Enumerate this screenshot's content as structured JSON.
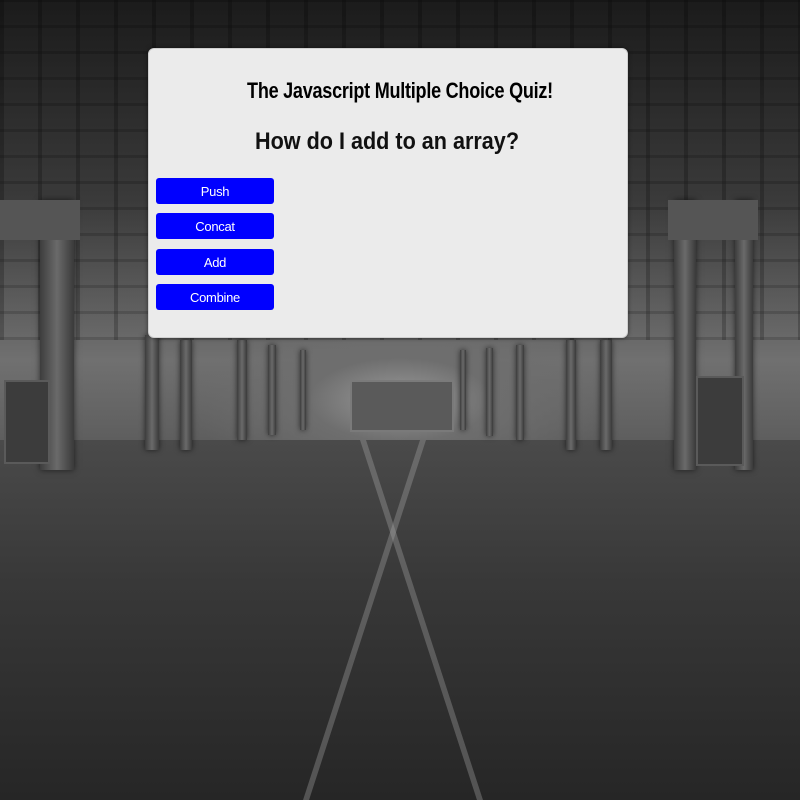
{
  "quiz": {
    "title": "The Javascript Multiple Choice Quiz!",
    "question": "How do I add to an array?",
    "answers": [
      {
        "label": "Push"
      },
      {
        "label": "Concat"
      },
      {
        "label": "Add"
      },
      {
        "label": "Combine"
      }
    ]
  },
  "colors": {
    "card_background": "#ebebeb",
    "answer_button": "#0000ff",
    "answer_text": "#ffffff"
  }
}
